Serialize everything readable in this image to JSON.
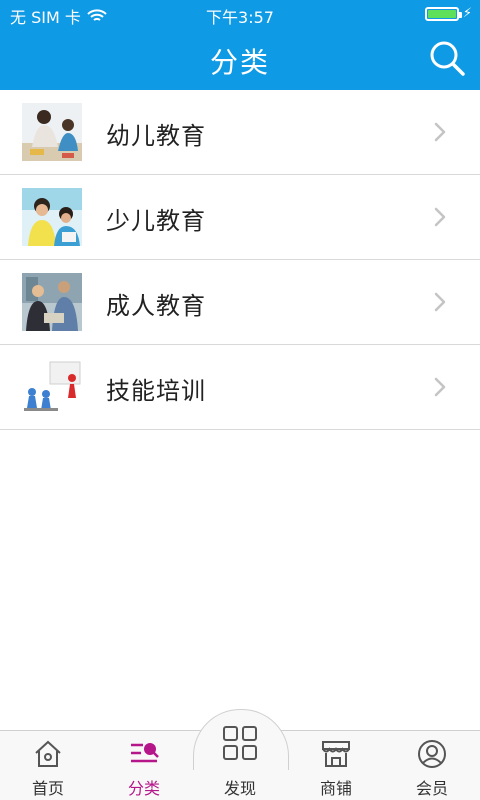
{
  "status_bar": {
    "carrier": "无 SIM 卡",
    "time": "下午3:57",
    "battery_level": 1.0
  },
  "nav": {
    "title": "分类",
    "search_icon": "search-icon"
  },
  "categories": [
    {
      "label": "幼儿教育",
      "icon": "preschool-photo"
    },
    {
      "label": "少儿教育",
      "icon": "children-photo"
    },
    {
      "label": "成人教育",
      "icon": "adult-photo"
    },
    {
      "label": "技能培训",
      "icon": "skill-training-photo"
    }
  ],
  "tabs": [
    {
      "label": "首页",
      "icon": "home-icon",
      "active": false
    },
    {
      "label": "分类",
      "icon": "category-icon",
      "active": true
    },
    {
      "label": "发现",
      "icon": "discover-icon",
      "active": false
    },
    {
      "label": "商铺",
      "icon": "store-icon",
      "active": false
    },
    {
      "label": "会员",
      "icon": "member-icon",
      "active": false
    }
  ],
  "colors": {
    "header": "#0e9ae4",
    "active_tab": "#b5178a",
    "battery": "#5fe05a"
  }
}
